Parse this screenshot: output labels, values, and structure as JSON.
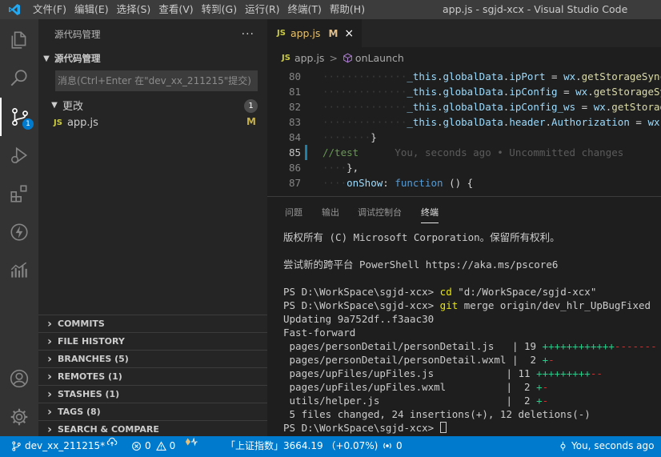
{
  "titlebar": {
    "menu": [
      "文件(F)",
      "编辑(E)",
      "选择(S)",
      "查看(V)",
      "转到(G)",
      "运行(R)",
      "终端(T)",
      "帮助(H)"
    ],
    "window_title": "app.js - sgjd-xcx - Visual Studio Code"
  },
  "activity": {
    "scm_badge": "1"
  },
  "sidebar": {
    "title": "源代码管理",
    "more": "···",
    "repo_section": "源代码管理",
    "commit_placeholder": "消息(Ctrl+Enter 在\"dev_xx_211215\"提交)",
    "changes_label": "更改",
    "changes_count": "1",
    "file": {
      "icon": "JS",
      "name": "app.js",
      "status": "M"
    },
    "panels": [
      "COMMITS",
      "FILE HISTORY",
      "BRANCHES (5)",
      "REMOTES (1)",
      "STASHES (1)",
      "TAGS (8)",
      "SEARCH & COMPARE"
    ]
  },
  "editor": {
    "tab": {
      "icon": "JS",
      "name": "app.js",
      "modified": "M",
      "close": "×"
    },
    "breadcrumb": {
      "icon": "JS",
      "file": "app.js",
      "separator": ">",
      "symbol": "onLaunch"
    },
    "lines": [
      {
        "n": "80",
        "dots": "··············",
        "parts": [
          [
            "v",
            "_this"
          ],
          [
            "p",
            "."
          ],
          [
            "v",
            "globalData"
          ],
          [
            "p",
            "."
          ],
          [
            "v",
            "ipPort"
          ],
          [
            "p",
            " = "
          ],
          [
            "v",
            "wx"
          ],
          [
            "p",
            "."
          ],
          [
            "f",
            "getStorageSync"
          ]
        ]
      },
      {
        "n": "81",
        "dots": "··············",
        "parts": [
          [
            "v",
            "_this"
          ],
          [
            "p",
            "."
          ],
          [
            "v",
            "globalData"
          ],
          [
            "p",
            "."
          ],
          [
            "v",
            "ipConfig"
          ],
          [
            "p",
            " = "
          ],
          [
            "v",
            "wx"
          ],
          [
            "p",
            "."
          ],
          [
            "f",
            "getStorageSy"
          ]
        ]
      },
      {
        "n": "82",
        "dots": "··············",
        "parts": [
          [
            "v",
            "_this"
          ],
          [
            "p",
            "."
          ],
          [
            "v",
            "globalData"
          ],
          [
            "p",
            "."
          ],
          [
            "v",
            "ipConfig_ws"
          ],
          [
            "p",
            " = "
          ],
          [
            "v",
            "wx"
          ],
          [
            "p",
            "."
          ],
          [
            "f",
            "getStorag"
          ]
        ]
      },
      {
        "n": "83",
        "dots": "··············",
        "parts": [
          [
            "v",
            "_this"
          ],
          [
            "p",
            "."
          ],
          [
            "v",
            "globalData"
          ],
          [
            "p",
            "."
          ],
          [
            "v",
            "header"
          ],
          [
            "p",
            "."
          ],
          [
            "v",
            "Authorization"
          ],
          [
            "p",
            " = "
          ],
          [
            "v",
            "wx"
          ],
          [
            "p",
            "."
          ]
        ]
      },
      {
        "n": "84",
        "dots": "········",
        "parts": [
          [
            "p",
            "}"
          ]
        ]
      },
      {
        "n": "85",
        "dots": "",
        "parts": [
          [
            "c",
            "//test"
          ],
          [
            "blame",
            "      You, seconds ago • Uncommitted changes"
          ]
        ]
      },
      {
        "n": "86",
        "dots": "····",
        "parts": [
          [
            "p",
            "},"
          ]
        ]
      },
      {
        "n": "87",
        "dots": "····",
        "parts": [
          [
            "v",
            "onShow"
          ],
          [
            "p",
            ": "
          ],
          [
            "k",
            "function"
          ],
          [
            "p",
            " () {"
          ]
        ]
      }
    ]
  },
  "panel": {
    "tabs": [
      "问题",
      "输出",
      "调试控制台",
      "终端"
    ],
    "terminal": [
      [
        [
          "t",
          "版权所有 (C) Microsoft Corporation。保留所有权利。"
        ]
      ],
      [],
      [
        [
          "t",
          "尝试新的跨平台 PowerShell https://aka.ms/pscore6"
        ]
      ],
      [],
      [
        [
          "t",
          "PS D:\\WorkSpace\\sgjd-xcx> "
        ],
        [
          "y",
          "cd"
        ],
        [
          "t",
          " "
        ],
        [
          "s",
          "\"d:/WorkSpace/sgjd-xcx\""
        ]
      ],
      [
        [
          "t",
          "PS D:\\WorkSpace\\sgjd-xcx> "
        ],
        [
          "y",
          "git"
        ],
        [
          "t",
          " merge origin/dev_hlr_UpBugFixed"
        ]
      ],
      [
        [
          "t",
          "Updating 9a752df..f3aac30"
        ]
      ],
      [
        [
          "t",
          "Fast-forward"
        ]
      ],
      [
        [
          "t",
          " pages/personDetail/personDetail.js   | 19 "
        ],
        [
          "g",
          "++++++++++++"
        ],
        [
          "r",
          "-------"
        ]
      ],
      [
        [
          "t",
          " pages/personDetail/personDetail.wxml |  2 "
        ],
        [
          "g",
          "+"
        ],
        [
          "r",
          "-"
        ]
      ],
      [
        [
          "t",
          " pages/upFiles/upFiles.js            | 11 "
        ],
        [
          "g",
          "+++++++++"
        ],
        [
          "r",
          "--"
        ]
      ],
      [
        [
          "t",
          " pages/upFiles/upFiles.wxml          |  2 "
        ],
        [
          "g",
          "+"
        ],
        [
          "r",
          "-"
        ]
      ],
      [
        [
          "t",
          " utils/helper.js                     |  2 "
        ],
        [
          "g",
          "+"
        ],
        [
          "r",
          "-"
        ]
      ],
      [
        [
          "t",
          " 5 files changed, 24 insertions(+), 12 deletions(-)"
        ]
      ],
      [
        [
          "t",
          "PS D:\\WorkSpace\\sgjd-xcx> "
        ],
        [
          "cursor",
          ""
        ]
      ]
    ]
  },
  "statusbar": {
    "branch": "dev_xx_211215*",
    "errors": "0",
    "warnings": "0",
    "stock": "「上证指数」3664.19 （+0.07%)",
    "ports": "0",
    "blame": "You, seconds ago"
  }
}
